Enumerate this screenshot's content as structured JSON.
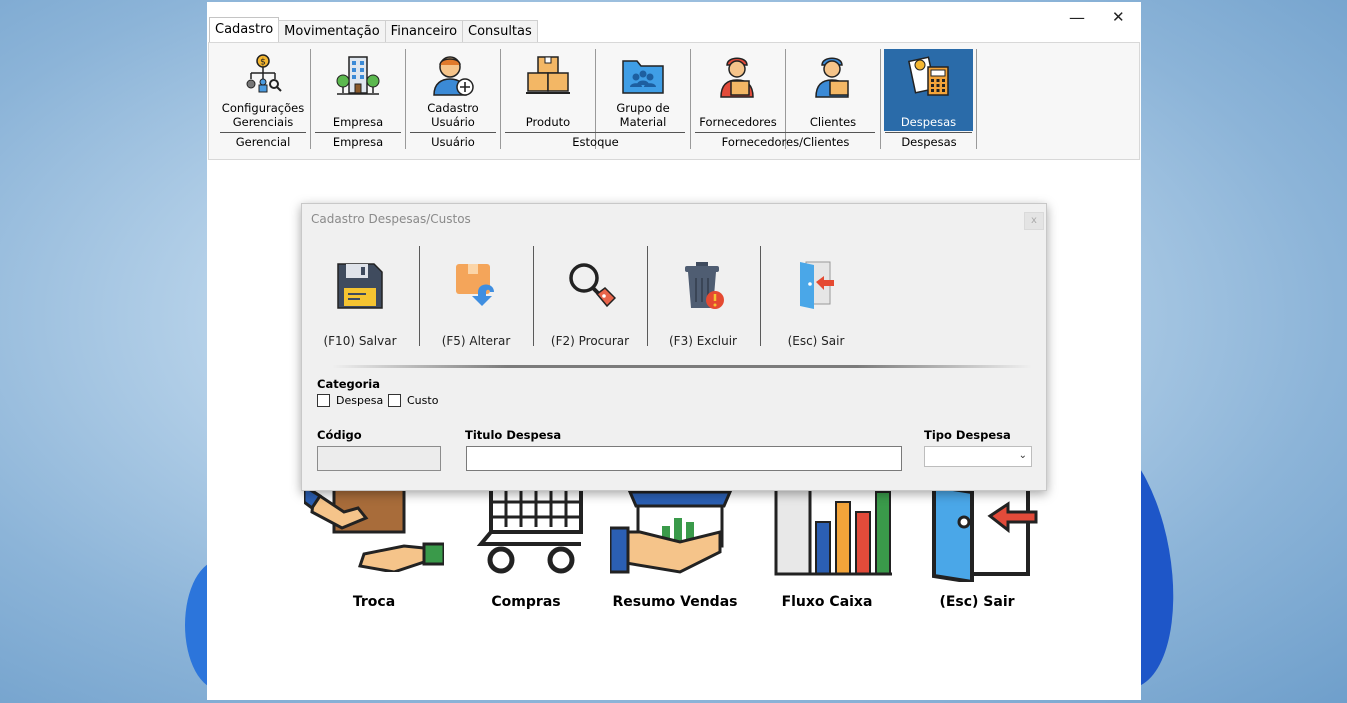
{
  "window": {
    "min_glyph": "—",
    "close_glyph": "✕"
  },
  "tabs": [
    "Cadastro",
    "Movimentação",
    "Financeiro",
    "Consultas"
  ],
  "ribbon": {
    "buttons": [
      {
        "line1": "Configurações",
        "line2": "Gerenciais",
        "icon": "org-chart-icon"
      },
      {
        "line1": "",
        "line2": "Empresa",
        "icon": "building-icon"
      },
      {
        "line1": "Cadastro",
        "line2": "Usuário",
        "icon": "add-user-icon"
      },
      {
        "line1": "",
        "line2": "Produto",
        "icon": "boxes-icon"
      },
      {
        "line1": "Grupo de",
        "line2": "Material",
        "icon": "folder-group-icon"
      },
      {
        "line1": "",
        "line2": "Fornecedores",
        "icon": "supplier-icon"
      },
      {
        "line1": "",
        "line2": "Clientes",
        "icon": "client-icon"
      },
      {
        "line1": "",
        "line2": "Despesas",
        "icon": "expense-calculator-icon"
      }
    ],
    "groups": [
      "Gerencial",
      "Empresa",
      "Usuário",
      "Estoque",
      "Fornecedores/Clientes",
      "Despesas"
    ]
  },
  "main_menu": [
    "Troca",
    "Compras",
    "Resumo Vendas",
    "Fluxo Caixa",
    "(Esc) Sair"
  ],
  "dialog": {
    "title": "Cadastro Despesas/Custos",
    "close_glyph": "x",
    "toolbar": [
      "(F10) Salvar",
      "(F5) Alterar",
      "(F2) Procurar",
      "(F3) Excluir",
      "(Esc) Sair"
    ],
    "categoria_label": "Categoria",
    "check_despesa": "Despesa",
    "check_custo": "Custo",
    "codigo_label": "Código",
    "titulo_label": "Titulo Despesa",
    "tipo_label": "Tipo Despesa",
    "codigo_value": "",
    "titulo_value": "",
    "tipo_value": ""
  },
  "colors": {
    "ribbon_selected": "#2a6ba9",
    "window_bg": "#ffffff",
    "dialog_bg": "#f0f0f0"
  }
}
